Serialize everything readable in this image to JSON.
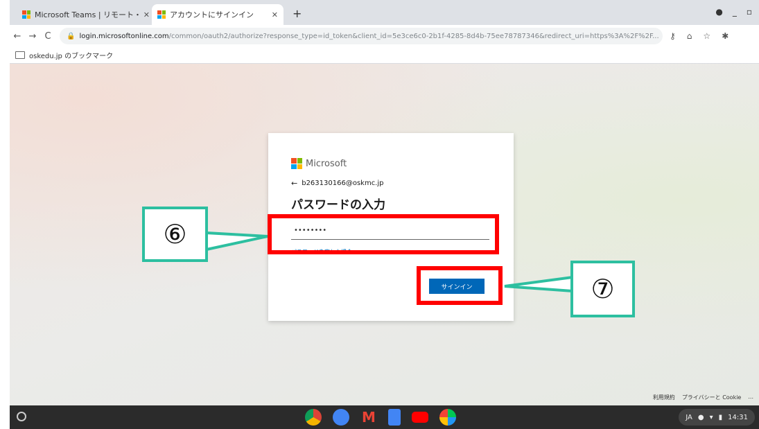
{
  "browser": {
    "tabs": [
      {
        "title": "Microsoft Teams | リモート・",
        "active": false
      },
      {
        "title": "アカウントにサインイン",
        "active": true
      }
    ],
    "new_tab_label": "+",
    "url_host": "login.microsoftonline.com",
    "url_rest": "/common/oauth2/authorize?response_type=id_token&client_id=5e3ce6c0-2b1f-4285-8d4b-75ee78787346&redirect_uri=https%3A%2F%2F...",
    "bookmark_folder": "oskedu.jp のブックマーク"
  },
  "signin": {
    "brand": "Microsoft",
    "account": "b263130166@oskmc.jp",
    "title": "パスワードの入力",
    "password_value": "••••••••",
    "forgot_link": "パスワードを忘れた場合",
    "signin_button": "サインイン"
  },
  "footer": {
    "terms": "利用規約",
    "privacy": "プライバシーと Cookie",
    "more": "..."
  },
  "shelf": {
    "lang": "JA",
    "time": "14:31"
  },
  "annotations": {
    "step6": "⑥",
    "step7": "⑦",
    "highlight_color": "#ff0000",
    "callout_border_color": "#2dbfa0"
  }
}
